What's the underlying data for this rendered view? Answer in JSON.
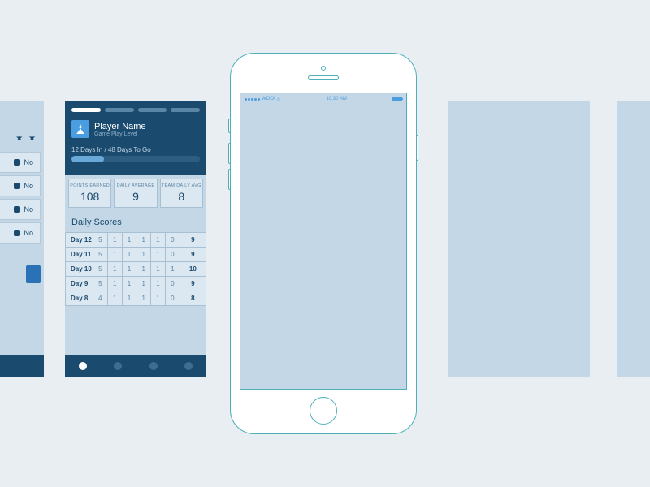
{
  "screen1": {
    "stars": "★ ★",
    "rows": [
      {
        "label": "No"
      },
      {
        "label": "No"
      },
      {
        "label": "No"
      },
      {
        "label": "No"
      }
    ]
  },
  "screen2": {
    "player_name": "Player Name",
    "player_sub": "Game Play Level",
    "progress_label": "12 Days In / 48 Days To Go",
    "stats": [
      {
        "label": "POINTS EARNED",
        "value": "108"
      },
      {
        "label": "DAILY AVERAGE",
        "value": "9"
      },
      {
        "label": "TEAM DAILY AVG",
        "value": "8"
      }
    ],
    "scores_title": "Daily Scores",
    "scores": [
      {
        "day": "Day 12",
        "c": [
          "5",
          "1",
          "1",
          "1",
          "1",
          "0"
        ],
        "total": "9"
      },
      {
        "day": "Day 11",
        "c": [
          "5",
          "1",
          "1",
          "1",
          "1",
          "0"
        ],
        "total": "9"
      },
      {
        "day": "Day 10",
        "c": [
          "5",
          "1",
          "1",
          "1",
          "1",
          "1"
        ],
        "total": "10"
      },
      {
        "day": "Day 9",
        "c": [
          "5",
          "1",
          "1",
          "1",
          "1",
          "0"
        ],
        "total": "9"
      },
      {
        "day": "Day 8",
        "c": [
          "4",
          "1",
          "1",
          "1",
          "1",
          "0"
        ],
        "total": "8"
      }
    ]
  },
  "statusbar": {
    "carrier": "WOO!",
    "time": "10:30 AM"
  }
}
